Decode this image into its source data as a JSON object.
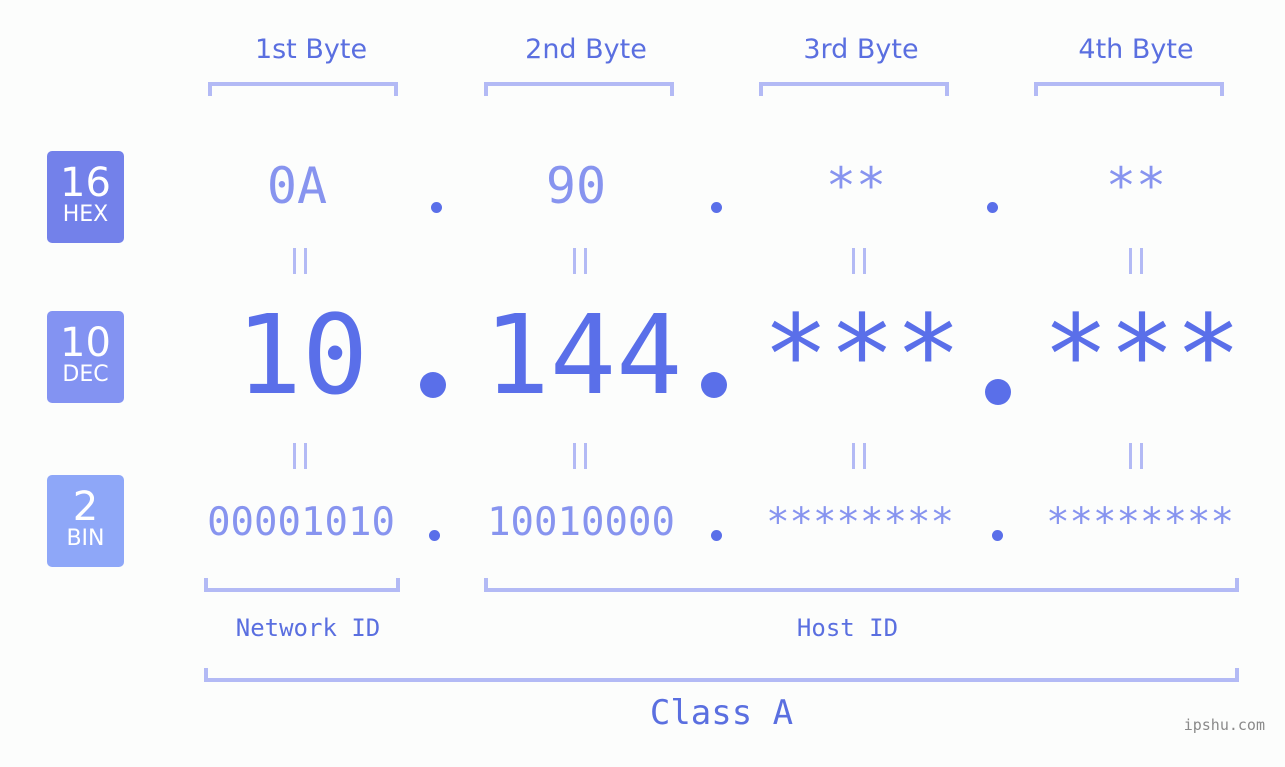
{
  "byte_headers": [
    "1st Byte",
    "2nd Byte",
    "3rd Byte",
    "4th Byte"
  ],
  "badges": {
    "hex": {
      "number": "16",
      "label": "HEX",
      "color": "#7381ea"
    },
    "dec": {
      "number": "10",
      "label": "DEC",
      "color": "#8393f2"
    },
    "bin": {
      "number": "2",
      "label": "BIN",
      "color": "#8ea7f8"
    }
  },
  "hex_values": [
    "0A",
    "90",
    "**",
    "**"
  ],
  "dec_values": [
    "10",
    "144",
    "***",
    "***"
  ],
  "bin_values": [
    "00001010",
    "10010000",
    "********",
    "********"
  ],
  "segments": {
    "network_id": "Network ID",
    "host_id": "Host ID"
  },
  "ip_class": "Class A",
  "watermark": "ipshu.com",
  "colors": {
    "accent": "#5a6fe9",
    "light_text": "#8794ef",
    "bracket": "#b3baf5"
  }
}
